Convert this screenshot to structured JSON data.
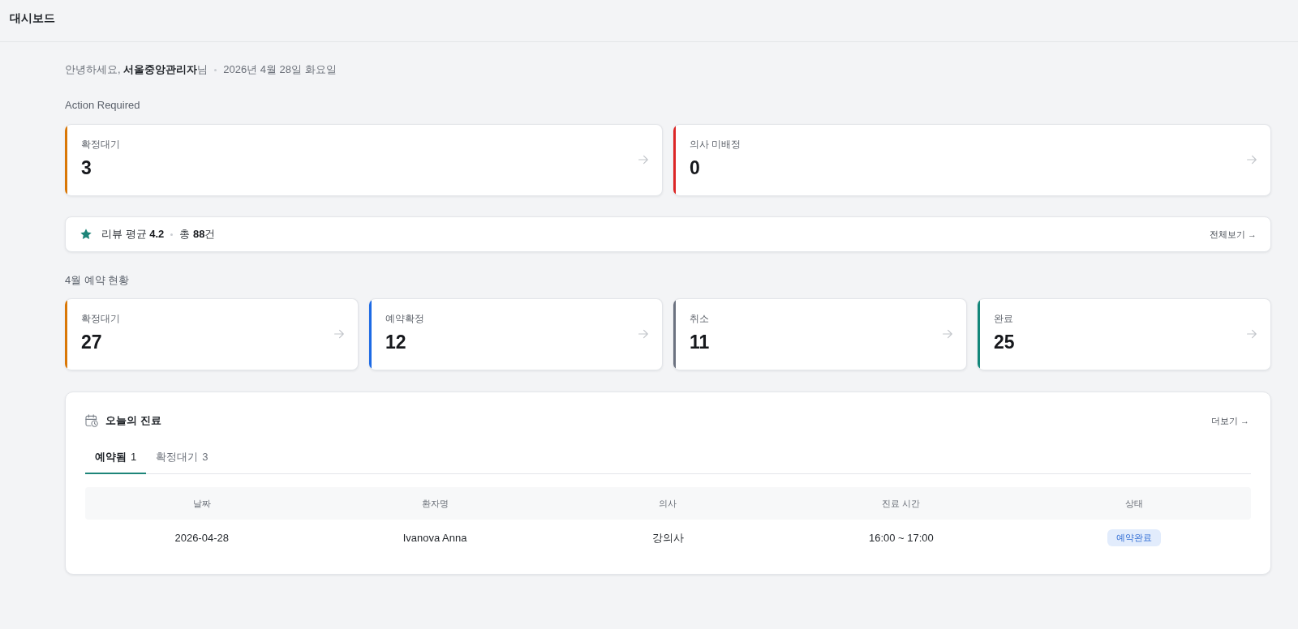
{
  "header": {
    "title": "대시보드"
  },
  "greeting": {
    "text": "안녕하세요, **서울중앙관리자**님",
    "date": "2026년 4월 28일 화요일"
  },
  "action_required": {
    "title": "Action Required",
    "cards": [
      {
        "label": "확정대기",
        "value": "3",
        "color": "#d97706"
      },
      {
        "label": "의사 미배정",
        "value": "0",
        "color": "#dc2626"
      }
    ]
  },
  "review": {
    "average": "리뷰 평균 **4.2**",
    "total": "총 **88**건",
    "link": "전체보기 →"
  },
  "monthly": {
    "title": "4월 예약 현황",
    "cards": [
      {
        "label": "확정대기",
        "value": "27",
        "color": "#d97706"
      },
      {
        "label": "예약확정",
        "value": "12",
        "color": "#1d6ae5"
      },
      {
        "label": "취소",
        "value": "11",
        "color": "#6b7280"
      },
      {
        "label": "완료",
        "value": "25",
        "color": "#13867a"
      }
    ]
  },
  "today": {
    "title": "오늘의 진료",
    "link": "더보기 →",
    "tabs": [
      {
        "label": "예약됨",
        "count": "1",
        "selected": true
      },
      {
        "label": "확정대기",
        "count": "3",
        "selected": false
      }
    ],
    "columns": [
      "날짜",
      "환자명",
      "의사",
      "진료 시간",
      "상태"
    ],
    "rows": [
      {
        "cells": [
          {
            "kind": "text",
            "text": "2026-04-28"
          },
          {
            "kind": "text",
            "text": "Ivanova Anna"
          },
          {
            "kind": "text",
            "text": "강의사"
          },
          {
            "kind": "text",
            "text": "16:00 ~ 17:00"
          },
          {
            "kind": "badge",
            "text": "예약완료"
          }
        ]
      }
    ]
  }
}
